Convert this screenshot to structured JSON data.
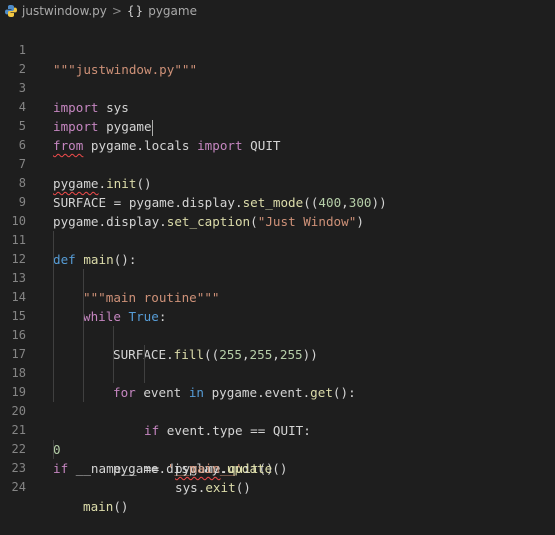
{
  "breadcrumb": {
    "file": "justwindow.py",
    "separator": ">",
    "symbol_icon": "{}",
    "symbol": "pygame"
  },
  "colors": {
    "background": "#1e1e1e",
    "keyword": "#c586c0",
    "keyword_blue": "#569cd6",
    "string": "#ce9178",
    "number": "#b5cea8",
    "function": "#dcdcaa",
    "variable": "#9cdcfe",
    "line_number": "#858585",
    "error_squiggle": "#f14c4c"
  },
  "editor": {
    "line_numbers": [
      "1",
      "2",
      "3",
      "4",
      "5",
      "6",
      "7",
      "8",
      "9",
      "10",
      "11",
      "12",
      "13",
      "14",
      "15",
      "16",
      "17",
      "18",
      "19",
      "20",
      "21",
      "22",
      "23",
      "24"
    ],
    "lines": {
      "l1": {
        "docstring": "\"\"\"justwindow.py\"\"\""
      },
      "l3": {
        "kw": "import",
        "mod": " sys"
      },
      "l4": {
        "kw": "import",
        "mod": " pygame"
      },
      "l5": {
        "kw1": "from",
        "mod": " pygame.locals ",
        "kw2": "import",
        "name": " QUIT"
      },
      "l7": {
        "obj": "pygame",
        "rest1": ".",
        "fn": "init",
        "rest2": "()"
      },
      "l8": {
        "var": "SURFACE",
        "eq": " = pygame.display.",
        "fn": "set_mode",
        "p1": "((",
        "n1": "400",
        "c": ",",
        "n2": "300",
        "p2": "))"
      },
      "l9": {
        "obj": "pygame.display.",
        "fn": "set_caption",
        "p1": "(",
        "str": "\"Just Window\"",
        "p2": ")"
      },
      "l11": {
        "kw": "def",
        "sp": " ",
        "fn": "main",
        "rest": "():"
      },
      "l12": {
        "docstring": "\"\"\"main routine\"\"\""
      },
      "l13": {
        "kw": "while",
        "sp": " ",
        "val": "True",
        "colon": ":"
      },
      "l14": {
        "obj": "SURFACE.",
        "fn": "fill",
        "p1": "((",
        "n1": "255",
        "c1": ",",
        "n2": "255",
        "c2": ",",
        "n3": "255",
        "p2": "))"
      },
      "l16": {
        "kw1": "for",
        "v": " event ",
        "kw2": "in",
        "obj": " pygame.event.",
        "fn": "get",
        "rest": "():"
      },
      "l17": {
        "kw": "if",
        "rest": " event.type == QUIT:"
      },
      "l18": {
        "obj": "pygame",
        "dot": ".",
        "fn": "quit",
        "rest": "()"
      },
      "l19": {
        "obj": "sys.",
        "fn": "exit",
        "rest": "()"
      },
      "l20": {
        "obj": "pygame.display.",
        "fn": "update",
        "rest": "()"
      },
      "l21": {
        "num": "0"
      },
      "l22": {
        "kw": "if",
        "name": " __name__ ",
        "eq": "== ",
        "str": "'__main__'",
        "colon": ":"
      },
      "l23": {
        "fn": "main",
        "rest": "()"
      }
    }
  }
}
